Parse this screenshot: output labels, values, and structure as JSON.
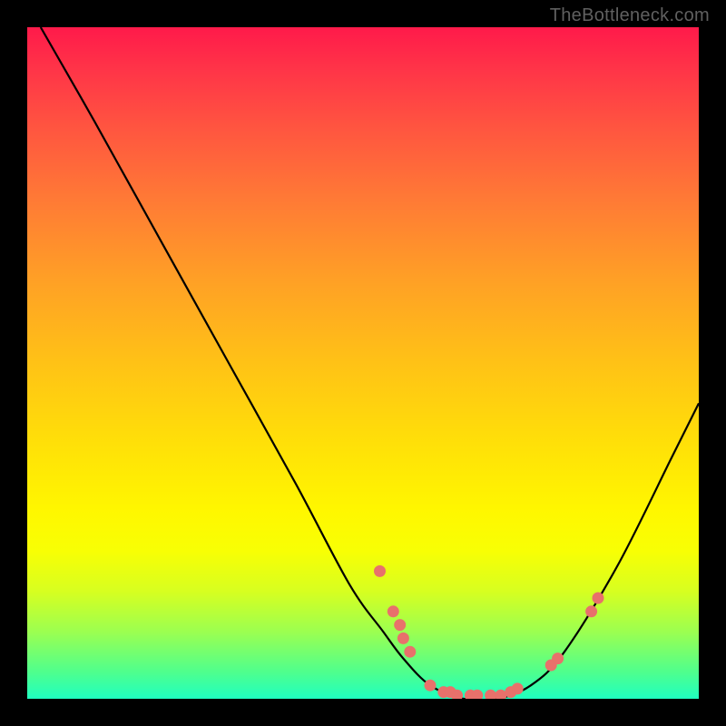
{
  "watermark": "TheBottleneck.com",
  "chart_data": {
    "type": "line",
    "title": "",
    "xlabel": "",
    "ylabel": "",
    "xlim": [
      0,
      100
    ],
    "ylim": [
      0,
      100
    ],
    "curve": {
      "description": "bottleneck V-curve; y=percentage (0 best), x=relative performance index",
      "points": [
        {
          "x": 2,
          "y": 100
        },
        {
          "x": 10,
          "y": 86
        },
        {
          "x": 20,
          "y": 68
        },
        {
          "x": 30,
          "y": 50
        },
        {
          "x": 40,
          "y": 32
        },
        {
          "x": 48,
          "y": 17
        },
        {
          "x": 53,
          "y": 10
        },
        {
          "x": 56,
          "y": 6
        },
        {
          "x": 60,
          "y": 2
        },
        {
          "x": 65,
          "y": 0
        },
        {
          "x": 70,
          "y": 0
        },
        {
          "x": 75,
          "y": 2
        },
        {
          "x": 80,
          "y": 7
        },
        {
          "x": 88,
          "y": 20
        },
        {
          "x": 96,
          "y": 36
        },
        {
          "x": 100,
          "y": 44
        }
      ]
    },
    "markers": [
      {
        "x": 52.5,
        "y": 19
      },
      {
        "x": 54.5,
        "y": 13
      },
      {
        "x": 55.5,
        "y": 11
      },
      {
        "x": 56,
        "y": 9
      },
      {
        "x": 57,
        "y": 7
      },
      {
        "x": 60,
        "y": 2
      },
      {
        "x": 62,
        "y": 1
      },
      {
        "x": 63,
        "y": 1
      },
      {
        "x": 64,
        "y": 0.5
      },
      {
        "x": 66,
        "y": 0.5
      },
      {
        "x": 67,
        "y": 0.5
      },
      {
        "x": 69,
        "y": 0.5
      },
      {
        "x": 70.5,
        "y": 0.5
      },
      {
        "x": 72,
        "y": 1
      },
      {
        "x": 73,
        "y": 1.5
      },
      {
        "x": 78,
        "y": 5
      },
      {
        "x": 79,
        "y": 6
      },
      {
        "x": 84,
        "y": 13
      },
      {
        "x": 85,
        "y": 15
      }
    ],
    "colors": {
      "gradient_top": "#ff1a4a",
      "gradient_bottom": "#1fffc0",
      "curve": "#000000",
      "markers": "#e8716b",
      "frame": "#000000"
    }
  }
}
